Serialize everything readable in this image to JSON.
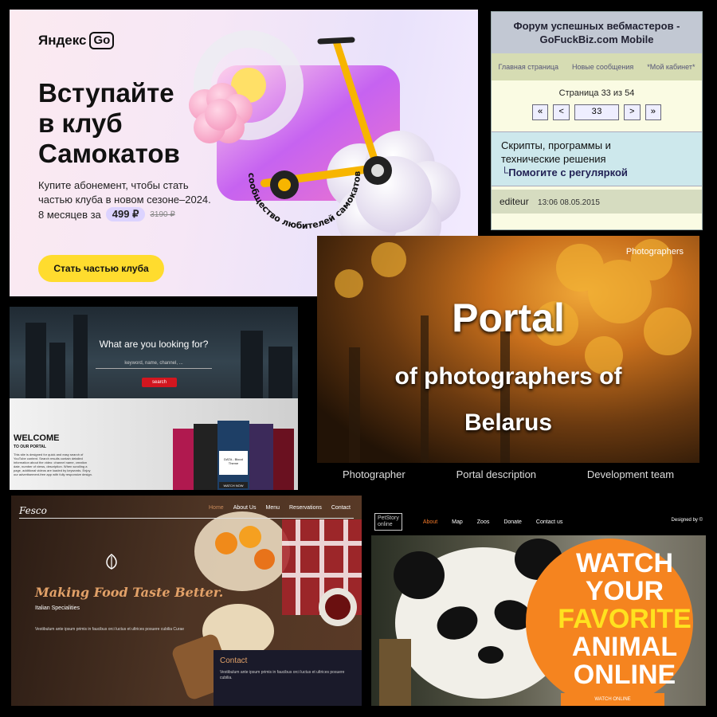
{
  "yandex": {
    "logo": "Яндекс",
    "logo_go": "Go",
    "title_line1": "Вступайте",
    "title_line2": "в клуб",
    "title_line3": "Самокатов",
    "subtitle": "Купите абонемент, чтобы стать частью клуба в новом сезоне–2024.",
    "price_prefix": "8 месяцев за",
    "price": "499 ₽",
    "old_price": "3190 ₽",
    "badge_text": "сообщество любителей самокатов",
    "cta": "Стать частью клуба"
  },
  "forum": {
    "title_line1": "Форум успешных вебмастеров -",
    "title_line2": "GoFuckBiz.com Mobile",
    "nav": [
      "Главная страница",
      "Новые сообщения",
      "*Мой кабинет*"
    ],
    "page_info": "Страница 33 из 54",
    "pager": [
      "«",
      "<",
      "33",
      ">",
      "»"
    ],
    "topic_line1": "Скрипты, программы и",
    "topic_line2": "технические решения",
    "topic_link": "Помогите с регуляркой",
    "post_author": "editeur",
    "post_time": "13:06 08.05.2015"
  },
  "portal": {
    "tag": "Photographers",
    "line1": "Portal",
    "line2": "of photographers of",
    "line3": "Belarus",
    "nav": [
      "Photographer",
      "Portal description",
      "Development team"
    ]
  },
  "video": {
    "question": "What are you looking for?",
    "placeholder": "keyword, name, channel, ...",
    "search_btn": "search",
    "welcome": "WELCOME",
    "welcome_sub": "TO OUR PORTAL",
    "desc": "This site is designed for quick and easy search of YouTube content. Search results contain detailed information about the video: channel name, creation date, number of views, description. When scrolling a page, additional videos are loaded by keywords. Enjoy our advertisement-free app with fully responsive design.",
    "card_caption": "DATA - Blood Theme",
    "watch_now": "WATCH NOW"
  },
  "fesco": {
    "logo": "Fesco",
    "nav": [
      "Home",
      "About Us",
      "Menu",
      "Reservations",
      "Contact"
    ],
    "headline": "Making Food Taste Better.",
    "subhead": "Italian Specialities",
    "body": "Vestibulum ante ipsum primis in faucibus orci luctus et ultrices posuere cubilia Curae",
    "contact_title": "Contact",
    "contact_body": "Vestibulum ante ipsum primis in faucibus orci luctus et ultrices posuere cubilia."
  },
  "petstory": {
    "logo_line1": "PetStory",
    "logo_line2": "online",
    "nav": [
      "About",
      "Map",
      "Zoos",
      "Donate",
      "Contact us"
    ],
    "designed_by": "Designed by ©",
    "line1": "WATCH",
    "line2": "YOUR",
    "line3": "FAVORITE",
    "line4": "ANIMAL",
    "line5": "ONLINE",
    "cta": "WATCH ONLINE"
  },
  "colors": {
    "yandex_yellow": "#ffdc2e",
    "pet_orange": "#f5841f",
    "pet_yellow": "#ffe21f",
    "video_red": "#d3161f",
    "fesco_accent": "#e2a168"
  }
}
